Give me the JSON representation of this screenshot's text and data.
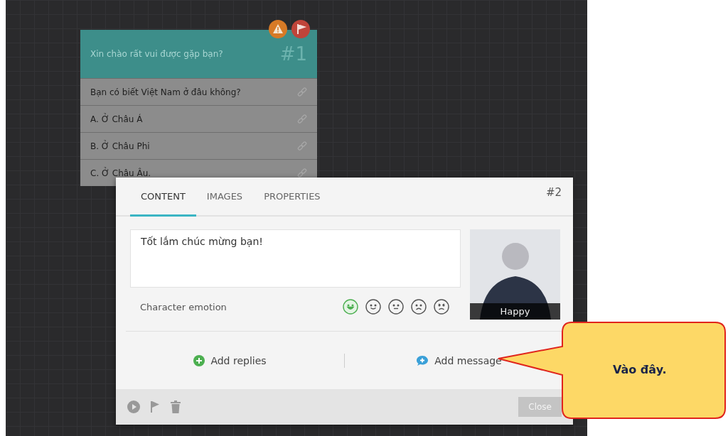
{
  "node": {
    "title": "Xin chào rất vui được gặp bạn?",
    "number": "#1",
    "badges": [
      {
        "kind": "warning"
      },
      {
        "kind": "flag"
      }
    ],
    "rows": [
      {
        "text": "Bạn có biết Việt Nam ở đâu không?"
      },
      {
        "text": "A. Ở Châu Á"
      },
      {
        "text": "B. Ở Châu Phi"
      },
      {
        "text": "C. Ở Châu Âu."
      }
    ]
  },
  "dialog": {
    "tabs": [
      {
        "label": "CONTENT",
        "selected": true
      },
      {
        "label": "IMAGES",
        "selected": false
      },
      {
        "label": "PROPERTIES",
        "selected": false
      }
    ],
    "number": "#2",
    "message": {
      "value": "Tốt lắm chúc mừng bạn!"
    },
    "emotion_label": "Character emotion",
    "emotions": [
      {
        "kind": "laugh",
        "selected": true
      },
      {
        "kind": "smile",
        "selected": false
      },
      {
        "kind": "neutral",
        "selected": false
      },
      {
        "kind": "sad",
        "selected": false
      },
      {
        "kind": "angry",
        "selected": false
      }
    ],
    "character_caption": "Happy",
    "actions": [
      {
        "kind": "replies",
        "label": "Add replies"
      },
      {
        "kind": "message",
        "label": "Add message"
      }
    ],
    "close": "Close"
  },
  "callout": {
    "text": "Vào đây."
  }
}
